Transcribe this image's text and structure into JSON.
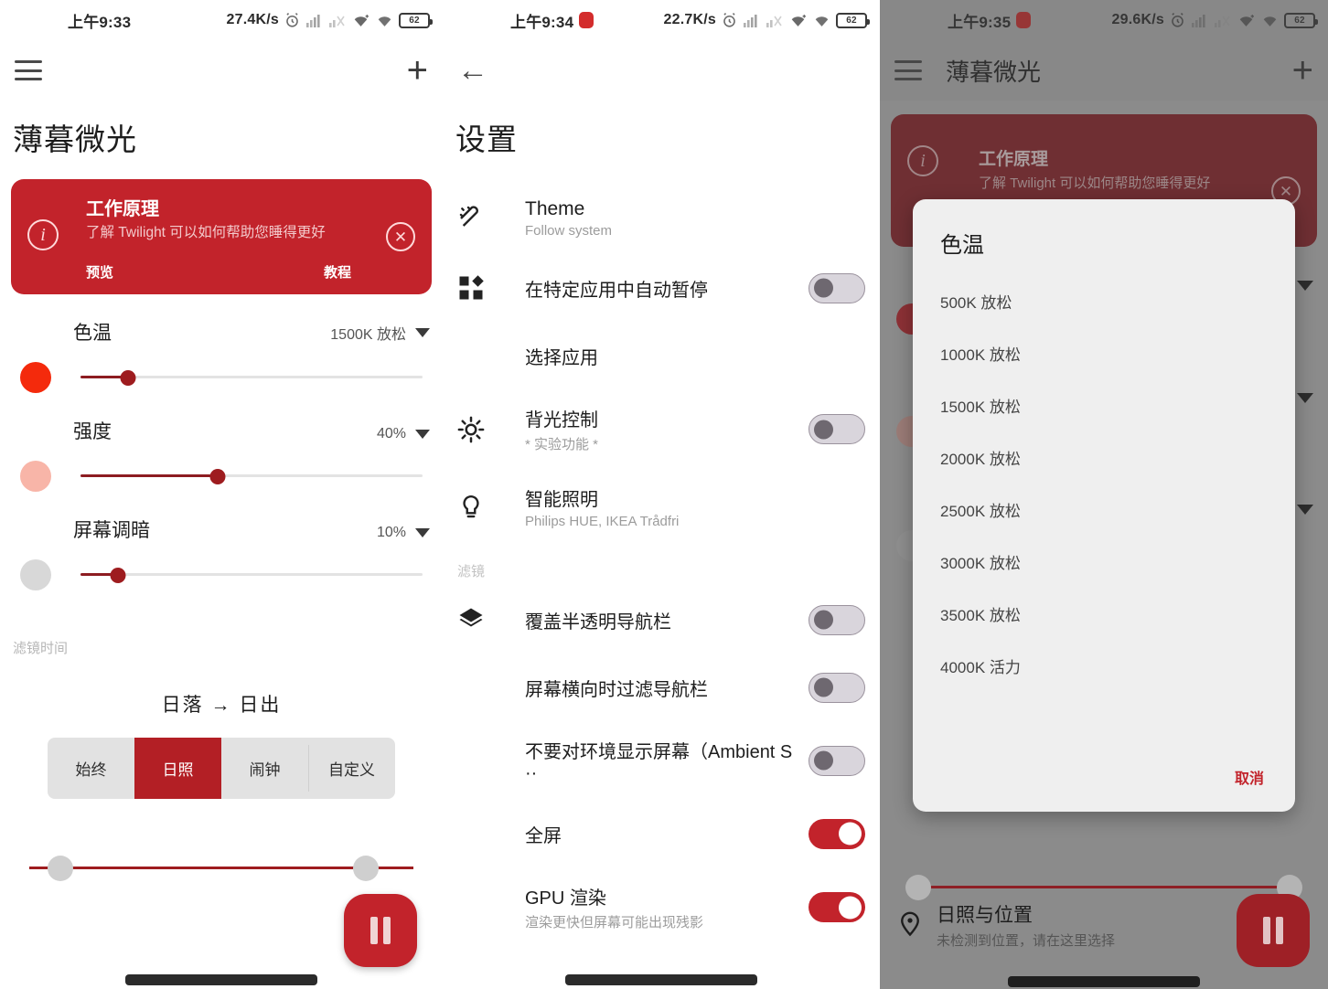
{
  "panel1": {
    "status": {
      "time": "上午9:33",
      "speed": "27.4K/s",
      "battery": "62"
    },
    "appbar": {
      "menu_icon": "hamburger-icon",
      "add_icon": "plus-icon"
    },
    "page_title": "薄暮微光",
    "info_card": {
      "title": "工作原理",
      "subtitle": "了解 Twilight 可以如何帮助您睡得更好",
      "action_left": "预览",
      "action_right": "教程",
      "info_glyph": "i",
      "close_glyph": "✕",
      "color": "#C2232B"
    },
    "sliders": [
      {
        "label": "色温",
        "value": "1500K 放松",
        "swatch": "#F42A0C",
        "fill_pct": 14
      },
      {
        "label": "强度",
        "value": "40%",
        "swatch": "#F8B5A8",
        "fill_pct": 40
      },
      {
        "label": "屏幕调暗",
        "value": "10%",
        "swatch": "#D8D8D8",
        "fill_pct": 11
      }
    ],
    "filter_time_caption": "滤镜时间",
    "range_title": "日落 → 日出",
    "segments": [
      {
        "label": "始终",
        "active": false
      },
      {
        "label": "日照",
        "active": true
      },
      {
        "label": "闹钟",
        "active": false
      },
      {
        "label": "自定义",
        "active": false
      }
    ],
    "fab": "pause-button"
  },
  "panel2": {
    "status": {
      "time": "上午9:34",
      "speed": "22.7K/s",
      "battery": "62"
    },
    "appbar": {
      "back_icon": "back-arrow-icon"
    },
    "page_title": "设置",
    "rows": [
      {
        "icon": "theme-icon",
        "title": "Theme",
        "sub": "Follow system",
        "toggle": null,
        "english": true
      },
      {
        "icon": "apps-grid-icon",
        "title": "在特定应用中自动暂停",
        "sub": "",
        "toggle": "off"
      },
      {
        "icon": "",
        "title": "选择应用",
        "sub": "",
        "toggle": null
      },
      {
        "icon": "brightness-icon",
        "title": "背光控制",
        "sub": "* 实验功能 *",
        "toggle": "off"
      },
      {
        "icon": "bulb-icon",
        "title": "智能照明",
        "sub": "Philips HUE, IKEA Trådfri",
        "toggle": null
      }
    ],
    "filter_caption": "滤镜",
    "rows2": [
      {
        "icon": "layers-icon",
        "title": "覆盖半透明导航栏",
        "sub": "",
        "toggle": "off"
      },
      {
        "icon": "",
        "title": "屏幕横向时过滤导航栏",
        "sub": "",
        "toggle": "off"
      },
      {
        "icon": "",
        "title": "不要对环境显示屏幕（Ambient S ··",
        "sub": "",
        "toggle": "off"
      },
      {
        "icon": "",
        "title": "全屏",
        "sub": "",
        "toggle": "on"
      },
      {
        "icon": "",
        "title": "GPU 渲染",
        "sub": "渲染更快但屏幕可能出现残影",
        "toggle": "on"
      }
    ]
  },
  "panel3": {
    "status": {
      "time": "上午9:35",
      "speed": "29.6K/s",
      "battery": "62"
    },
    "appbar": {
      "menu_icon": "hamburger-icon",
      "title": "薄暮微光",
      "add_icon": "plus-icon"
    },
    "info_card": {
      "title": "工作原理",
      "subtitle": "了解 Twilight 可以如何帮助您睡得更好",
      "close_glyph": "✕",
      "info_glyph": "i"
    },
    "dialog": {
      "title": "色温",
      "options": [
        "500K 放松",
        "1000K 放松",
        "1500K 放松",
        "2000K 放松",
        "2500K 放松",
        "3000K 放松",
        "3500K 放松",
        "4000K 活力"
      ],
      "cancel": "取消",
      "cancel_color": "#C2232B"
    },
    "location": {
      "title": "日照与位置",
      "sub": "未检测到位置，请在这里选择",
      "icon": "location-pin-icon"
    },
    "fab": "pause-button"
  }
}
